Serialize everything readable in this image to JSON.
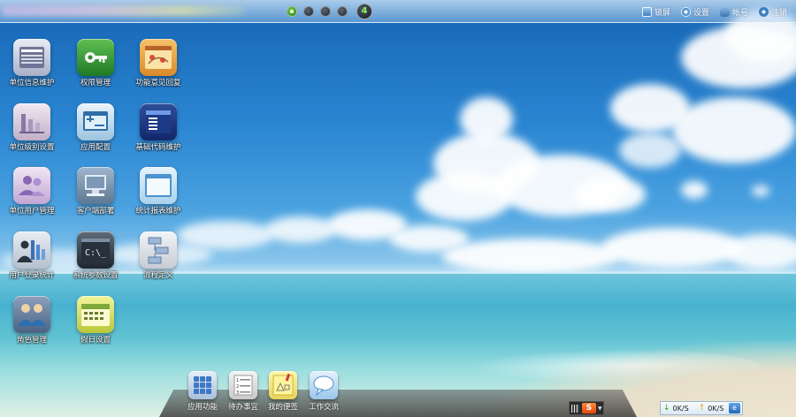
{
  "topbar": {
    "current_page": "4",
    "actions": [
      {
        "name": "lock",
        "label": "锁屏"
      },
      {
        "name": "settings",
        "label": "设置"
      },
      {
        "name": "user",
        "label": "帐号"
      },
      {
        "name": "logout",
        "label": "注销"
      }
    ]
  },
  "apps": [
    {
      "label": "单位信息维护"
    },
    {
      "label": "权限管理"
    },
    {
      "label": "功能意见回复"
    },
    {
      "label": "单位级别设置"
    },
    {
      "label": "应用配置"
    },
    {
      "label": "基础代码维护"
    },
    {
      "label": "单位用户管理"
    },
    {
      "label": "客户端部署"
    },
    {
      "label": "统计报表维护"
    },
    {
      "label": "用户登录统计"
    },
    {
      "label": "系统参数设置"
    },
    {
      "label": "流程定义"
    },
    {
      "label": "角色管理"
    },
    {
      "label": "假日设置"
    }
  ],
  "dock": [
    {
      "label": "应用功能"
    },
    {
      "label": "待办事宜"
    },
    {
      "label": "我的便签"
    },
    {
      "label": "工作交流"
    }
  ],
  "tray": {
    "ime_label": "S",
    "download_speed": "0K/S",
    "upload_speed": "0K/S"
  },
  "colors": {
    "sky_top": "#1665b4",
    "sea": "#48b2cf",
    "page_badge_text": "#8df05a"
  }
}
